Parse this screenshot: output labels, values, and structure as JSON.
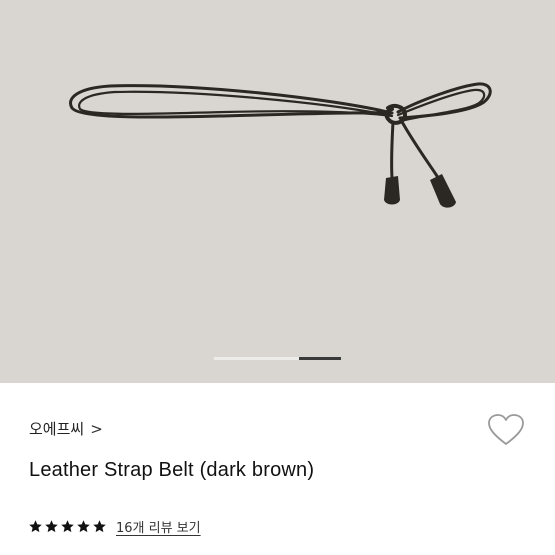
{
  "product": {
    "brand": "오에프씨",
    "brand_chevron": ">",
    "title": "Leather Strap Belt (dark brown)",
    "rating": {
      "stars": 5,
      "max": 5
    },
    "review_link": "16개 리뷰 보기"
  },
  "carousel": {
    "total_slides": 3,
    "active_slide": 3
  },
  "colors": {
    "image_background": "#d9d6d1",
    "belt": "#2b2722",
    "indicator_active": "#3a3a3a",
    "indicator_track": "#eeece9",
    "star": "#111111"
  },
  "icons": {
    "wishlist": "heart-outline-icon",
    "brand_chevron": "chevron-right-icon",
    "star": "star-icon"
  }
}
